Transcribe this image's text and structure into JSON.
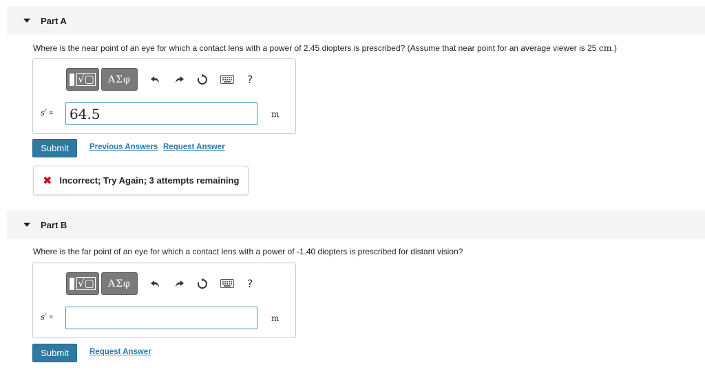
{
  "parts": [
    {
      "title": "Part A",
      "question": "Where is the near point of an eye for which a contact lens with a power of 2.45 diopters is prescribed? (Assume that near point for an average viewer is 25 ",
      "question_unit": "cm",
      "question_end": ".)",
      "variable": "s′",
      "equals": "=",
      "answer_value": "64.5",
      "unit": "m",
      "submit_label": "Submit",
      "previous_answers_label": "Previous Answers",
      "request_answer_label": "Request Answer",
      "feedback": {
        "icon": "x-icon",
        "message": "Incorrect; Try Again; 3 attempts remaining",
        "color": "#d0021b"
      }
    },
    {
      "title": "Part B",
      "question": "Where is the far point of an eye for which a contact lens with a power of -1.40 diopters is prescribed for distant vision?",
      "variable": "s′",
      "equals": "=",
      "answer_value": "",
      "unit": "m",
      "submit_label": "Submit",
      "request_answer_label": "Request Answer"
    }
  ],
  "toolbar": {
    "template_glyph": "√▢",
    "greek_label": "ΑΣφ",
    "help_label": "?",
    "icons": [
      "templates-icon",
      "greek-symbols-icon",
      "undo-icon",
      "redo-icon",
      "reset-icon",
      "keyboard-icon",
      "help-icon"
    ]
  },
  "colors": {
    "submit_bg": "#2e7aa0",
    "link": "#2a7ab0",
    "input_border": "#4a90b8",
    "header_bg": "#f5f5f5",
    "toolbar_bg": "#7a7a7a"
  }
}
